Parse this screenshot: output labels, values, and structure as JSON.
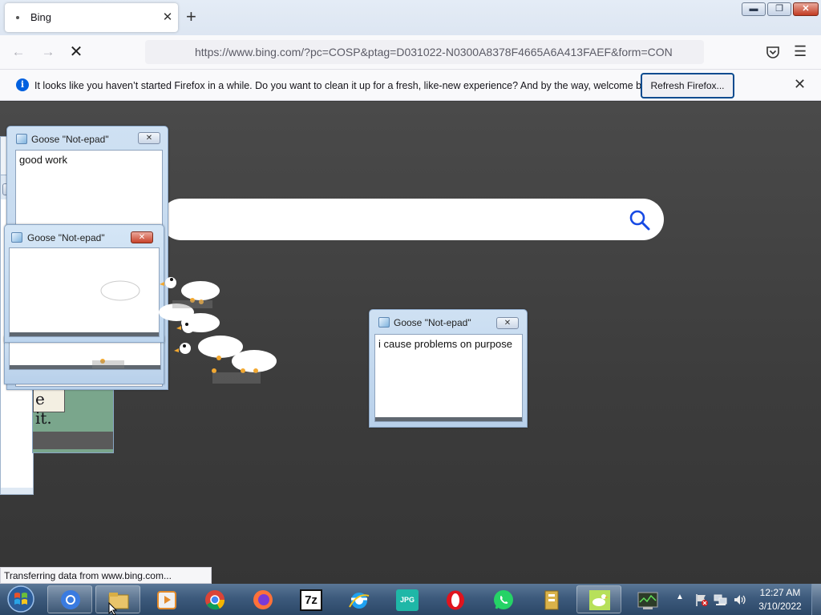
{
  "browser": {
    "tab_title": "Bing",
    "tab_close": "✕",
    "new_tab": "+",
    "url": "https://www.bing.com/?pc=COSP&ptag=D031022-N0300A8378F4665A6A413FAEF&form=CON",
    "notification": {
      "text": "It looks like you haven’t started Firefox in a while. Do you want to clean it up for a fresh, like-new experience? And by the way, welcome back!",
      "button": "Refresh Firefox...",
      "info_icon": "i"
    },
    "status_text": "Transferring data from www.bing.com..."
  },
  "window_controls": {
    "minimize": "▬",
    "maximize": "❐",
    "close": "✕"
  },
  "goose_windows": [
    {
      "title": "Goose \"Not-epad\"",
      "text": "good work"
    },
    {
      "title": "Goose \"Not-epad\"",
      "text": ""
    },
    {
      "title": "Goose \"Not-epad\"",
      "text": "i cause problems on purpose"
    }
  ],
  "background_fragment_text": "e it.",
  "taskbar": {
    "apps": [
      "Chrome-like browser",
      "Windows Explorer",
      "Media Player",
      "Google Chrome",
      "Firefox",
      "7-Zip",
      "Internet Explorer",
      "JPG Viewer",
      "Opera",
      "WhatsApp",
      "Archive",
      "Desktop Goose",
      "Task Manager"
    ],
    "seven_zip_label": "7z",
    "jpg_label": "JPG",
    "time": "12:27 AM",
    "date": "3/10/2022"
  }
}
